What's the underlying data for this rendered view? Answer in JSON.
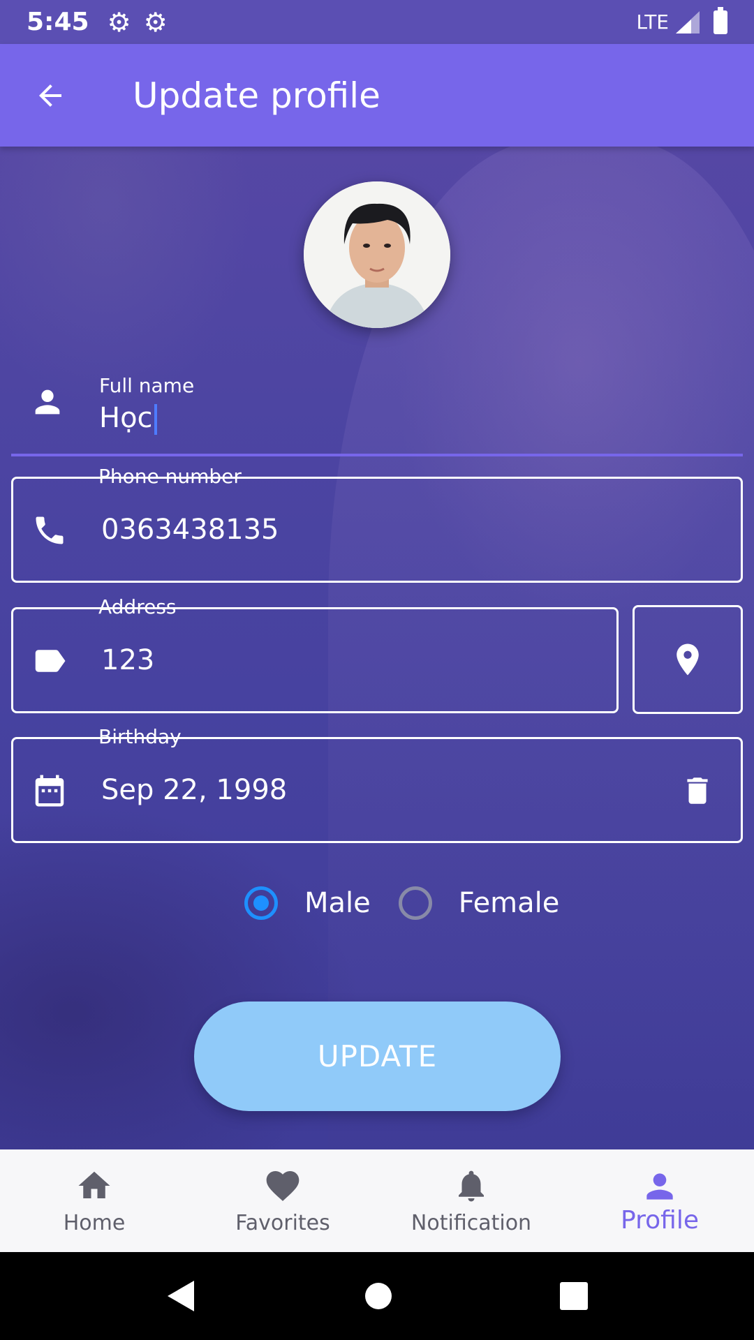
{
  "status_bar": {
    "time": "5:45",
    "network": "LTE"
  },
  "app_bar": {
    "title": "Update profile"
  },
  "form": {
    "full_name": {
      "label": "Full name",
      "value": "Học"
    },
    "phone": {
      "label": "Phone number",
      "value": "0363438135"
    },
    "address": {
      "label": "Address",
      "value": "123"
    },
    "birthday": {
      "label": "Birthday",
      "value": "Sep 22, 1998"
    },
    "gender": {
      "options": [
        "Male",
        "Female"
      ],
      "selected": "Male"
    },
    "submit_label": "UPDATE"
  },
  "bottom_nav": {
    "items": [
      {
        "label": "Home",
        "icon": "home-icon"
      },
      {
        "label": "Favorites",
        "icon": "heart-icon"
      },
      {
        "label": "Notification",
        "icon": "bell-icon"
      },
      {
        "label": "Profile",
        "icon": "person-icon"
      }
    ],
    "active": "Profile"
  },
  "colors": {
    "app_bar": "#7766ea",
    "status_bar": "#5b4fb3",
    "accent_active": "#7766ea",
    "radio_checked": "#1e90ff",
    "update_button": "#90caf9"
  }
}
